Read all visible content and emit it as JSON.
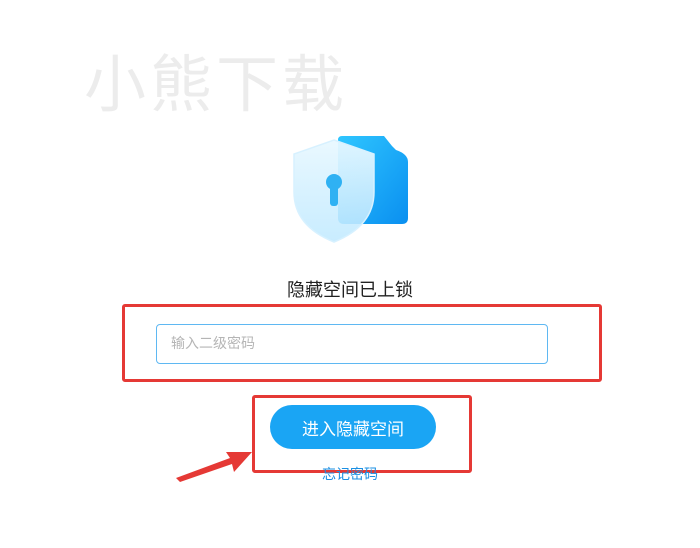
{
  "watermark": {
    "text": "小熊下载"
  },
  "lock_screen": {
    "title": "隐藏空间已上锁",
    "password_placeholder": "输入二级密码",
    "password_value": "",
    "enter_button_label": "进入隐藏空间",
    "forgot_link_label": "忘记密码"
  },
  "icons": {
    "lock_illustration": "shield-lock-icon",
    "annotation_arrow": "arrow-icon"
  },
  "colors": {
    "primary": "#1aa5f4",
    "link": "#1a8fe3",
    "annotation": "#e53935",
    "input_border": "#5fb8f2"
  }
}
